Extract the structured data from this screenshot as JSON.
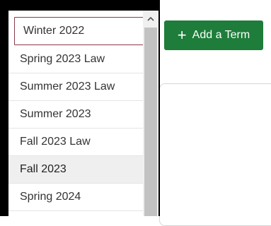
{
  "toolbar": {
    "add_term_label": "Add a Term",
    "add_term_icon": "plus-icon"
  },
  "term_select": {
    "selected_value": "Winter 2022",
    "highlighted_value": "Fall 2023",
    "options": [
      "Spring 2023 Law",
      "Summer 2023 Law",
      "Summer 2023",
      "Fall 2023 Law",
      "Fall 2023",
      "Spring 2024"
    ],
    "scroll_up_icon": "chevron-up-icon"
  },
  "colors": {
    "accent_green": "#1e7d3a",
    "selected_border": "#8a3a4a",
    "highlight_bg": "#efefef"
  }
}
